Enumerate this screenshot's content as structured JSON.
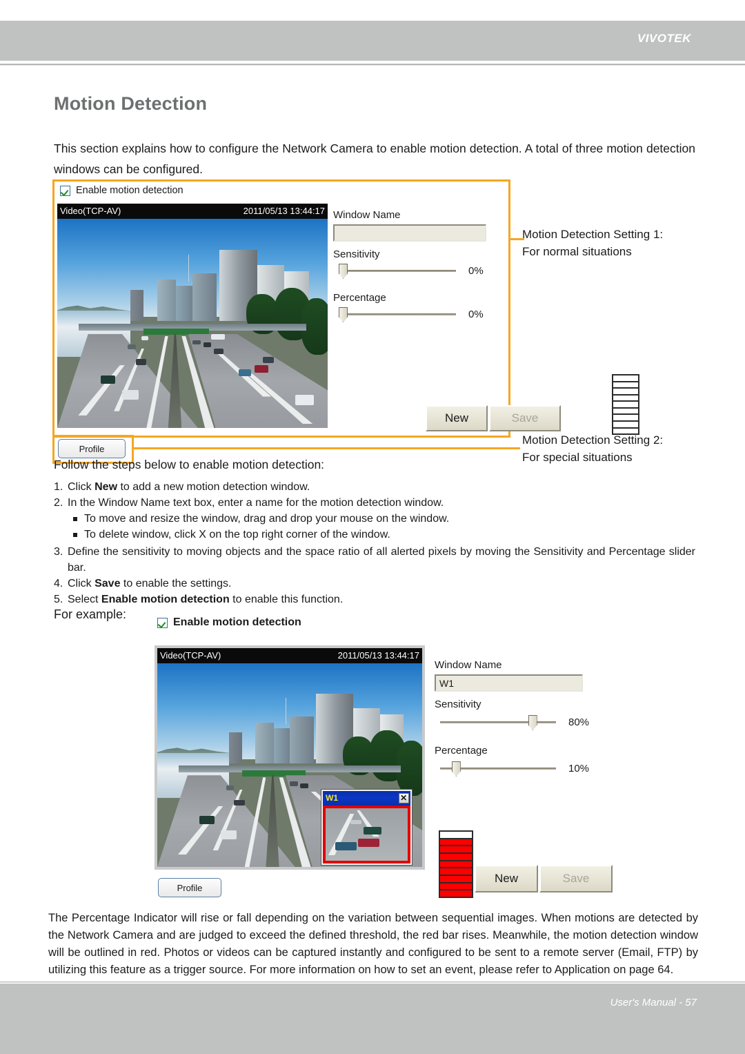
{
  "header": {
    "brand": "VIVOTEK"
  },
  "footer": {
    "text": "User's Manual - 57"
  },
  "page": {
    "title": "Motion Detection",
    "intro": "This section explains how to configure the Network Camera to enable motion detection. A total of three motion detection windows can be configured.",
    "follow_line": "Follow the steps below to enable motion detection:",
    "for_example": "For example:",
    "closing": "The Percentage Indicator will rise or fall depending on the variation between sequential images. When motions are detected by the Network Camera and are judged to exceed the defined threshold, the red bar rises. Meanwhile, the motion detection window will be outlined in red. Photos or videos can be captured instantly and configured to be sent to a remote server (Email, FTP) by utilizing this feature as a trigger source. For more information on how to set an event, please refer to Application on page 64."
  },
  "steps": [
    {
      "num": "1.",
      "pre": "Click ",
      "bold": "New",
      "post": " to add a new motion detection window."
    },
    {
      "num": "2.",
      "pre": "In the Window Name text box, enter a name for the motion detection window.",
      "bold": "",
      "post": ""
    },
    {
      "num": "3.",
      "pre": "Define the sensitivity to moving objects and the space ratio of all alerted pixels by moving the Sensitivity and Percentage slider bar.",
      "bold": "",
      "post": ""
    },
    {
      "num": "4.",
      "pre": "Click ",
      "bold": "Save",
      "post": " to enable the settings."
    },
    {
      "num": "5.",
      "pre": "Select ",
      "bold": "Enable motion detection",
      "post": " to enable this function."
    }
  ],
  "sub_bullets": [
    "To move and resize the window, drag and drop your mouse on the window.",
    "To delete window, click X on the top right corner of the window."
  ],
  "annotations": {
    "setting1": "Motion Detection Setting 1:\nFor normal situations",
    "setting1_line1": "Motion Detection Setting 1:",
    "setting1_line2": "For normal situations",
    "setting2_line1": "Motion Detection Setting 2:",
    "setting2_line2": "For special situations",
    "highlight_color": "#f5a623"
  },
  "panel1": {
    "enable_checkbox_label": "Enable motion detection",
    "video": {
      "stream_label": "Video(TCP-AV)",
      "timestamp": "2011/05/13 13:44:17"
    },
    "controls": {
      "window_name_label": "Window Name",
      "window_name_value": "",
      "window_name_placeholder": "",
      "sensitivity_label": "Sensitivity",
      "sensitivity_value": "0%",
      "sensitivity_percent": 0,
      "percentage_label": "Percentage",
      "percentage_value": "0%",
      "percentage_percent": 0,
      "indicator_segments": 9,
      "indicator_filled": 0,
      "new_button": "New",
      "save_button": "Save",
      "save_disabled": true
    },
    "profile_button": "Profile"
  },
  "panel2": {
    "enable_checkbox_label": "Enable motion detection",
    "video": {
      "stream_label": "Video(TCP-AV)",
      "timestamp": "2011/05/13 13:44:17"
    },
    "md_window": {
      "name": "W1",
      "close_label": "✕",
      "outline_color": "#e00000"
    },
    "controls": {
      "window_name_label": "Window Name",
      "window_name_value": "W1",
      "sensitivity_label": "Sensitivity",
      "sensitivity_value": "80%",
      "sensitivity_percent": 80,
      "percentage_label": "Percentage",
      "percentage_value": "10%",
      "percentage_percent": 10,
      "indicator_segments": 9,
      "indicator_filled": 8,
      "new_button": "New",
      "save_button": "Save",
      "save_disabled": true
    },
    "profile_button": "Profile"
  },
  "colors": {
    "header_gray": "#c0c2c2",
    "title_gray": "#6d6f70",
    "accent_orange": "#f5a623",
    "indicator_red": "#ff0000",
    "titlebar_blue": "#0b2fa8",
    "window_name_yellow": "#f5e32a"
  }
}
